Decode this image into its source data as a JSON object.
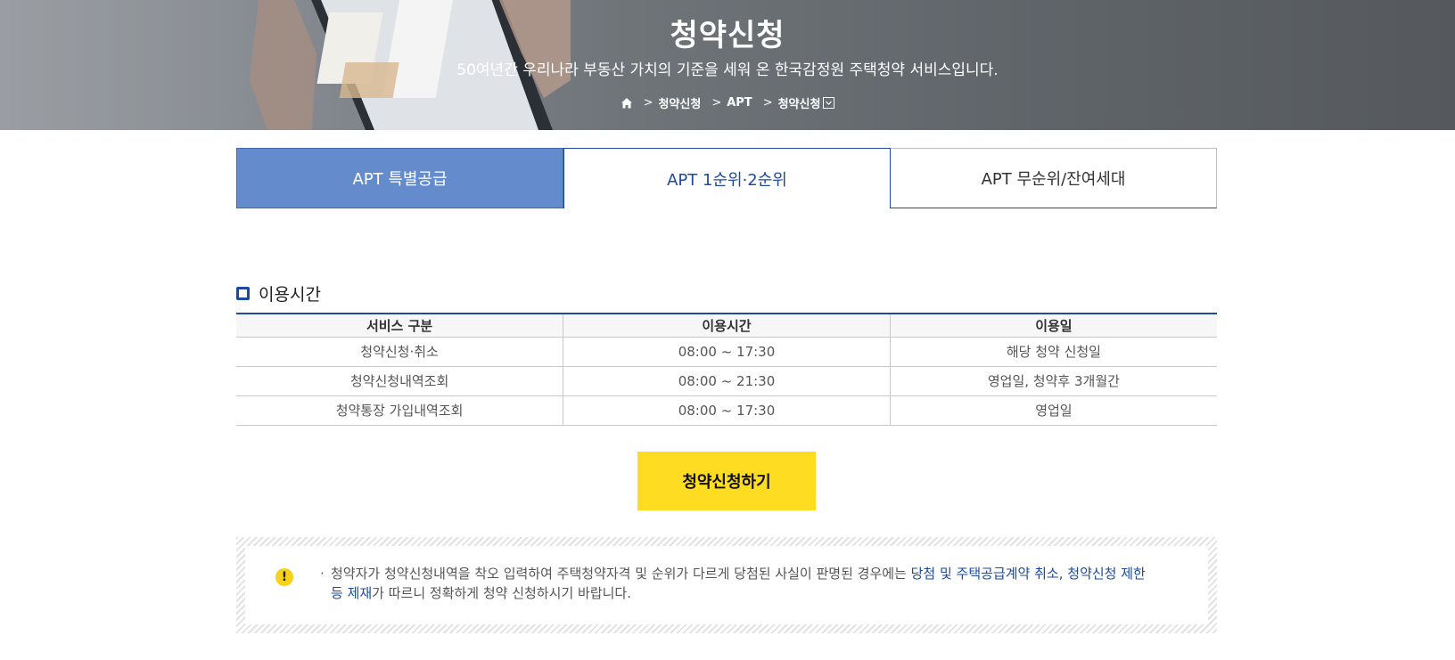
{
  "hero": {
    "title": "청약신청",
    "subtitle": "50여년간 우리나라 부동산 가치의 기준을 세워 온 한국감정원 주택청약 서비스입니다.",
    "breadcrumb": [
      "청약신청",
      "APT",
      "청약신청"
    ]
  },
  "tabs": [
    {
      "label": "APT 특별공급"
    },
    {
      "label": "APT 1순위·2순위"
    },
    {
      "label": "APT 무순위/잔여세대"
    }
  ],
  "section": {
    "title": "이용시간"
  },
  "table": {
    "headers": [
      "서비스 구분",
      "이용시간",
      "이용일"
    ],
    "rows": [
      [
        "청약신청·취소",
        "08:00 ~ 17:30",
        "해당 청약 신청일"
      ],
      [
        "청약신청내역조회",
        "08:00 ~ 21:30",
        "영업일, 청약후 3개월간"
      ],
      [
        "청약통장 가입내역조회",
        "08:00 ~ 17:30",
        "영업일"
      ]
    ]
  },
  "apply_button": "청약신청하기",
  "notice": {
    "bullet": "·",
    "text_part1": "청약자가 청약신청내역을 착오 입력하여 주택청약자격 및 순위가 다르게 당첨된 사실이 판명된 경우에는 ",
    "highlight": "당첨 및 주택공급계약 취소, 청약신청 제한 등 제재",
    "text_part2": "가 따르니 정확하게 청약 신청하시기 바랍니다."
  },
  "colors": {
    "accent_blue": "#1d4aa0",
    "tab_active_bg": "#648ccd",
    "button_yellow": "#fddc21"
  }
}
